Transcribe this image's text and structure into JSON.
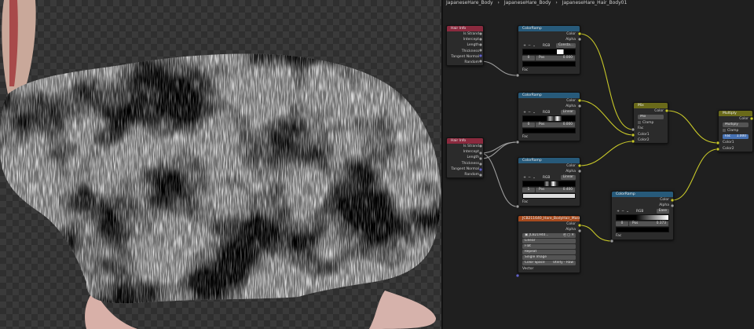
{
  "breadcrumb": [
    "JapaneseHare_Body",
    "JapaneseHare_Body",
    "JapaneseHare_Hair_Body01"
  ],
  "nodes": {
    "hair_info_1": {
      "title": "Hair Info",
      "outputs": [
        "Is Strand",
        "Intercept",
        "Length",
        "Thickness",
        "Tangent Normal",
        "Random"
      ]
    },
    "hair_info_2": {
      "title": "Hair Info",
      "outputs": [
        "Is Strand",
        "Intercept",
        "Length",
        "Thickness",
        "Tangent Normal",
        "Random"
      ]
    },
    "ramp_1": {
      "title": "ColorRamp",
      "outputs": [
        "Color",
        "Alpha"
      ],
      "color_mode": "RGB",
      "interpolation": "Consta...",
      "stop_index": "0",
      "pos_label": "Pos",
      "pos_value": "0.000",
      "input": "Fac"
    },
    "ramp_2": {
      "title": "ColorRamp",
      "outputs": [
        "Color",
        "Alpha"
      ],
      "color_mode": "RGB",
      "interpolation": "Linear",
      "stop_index": "0",
      "pos_label": "Pos",
      "pos_value": "0.000",
      "input": "Fac"
    },
    "ramp_3": {
      "title": "ColorRamp",
      "outputs": [
        "Color",
        "Alpha"
      ],
      "color_mode": "RGB",
      "interpolation": "Linear",
      "stop_index": "1",
      "pos_label": "Pos",
      "pos_value": "0.400",
      "input": "Fac"
    },
    "ramp_4": {
      "title": "ColorRamp",
      "outputs": [
        "Color",
        "Alpha"
      ],
      "color_mode": "RGB",
      "interpolation": "Ease",
      "stop_index": "0",
      "pos_label": "Pos",
      "pos_value": "0.373",
      "input": "Fac"
    },
    "mix": {
      "title": "Mix",
      "output": "Color",
      "mode": "Mix",
      "clamp": "Clamp",
      "inputs": [
        "Fac",
        "Color1",
        "Color2"
      ]
    },
    "multiply": {
      "title": "Multiply",
      "output": "Color",
      "mode": "Multiply",
      "clamp": "Clamp",
      "fac_label": "Fac",
      "fac_value": "1.000",
      "inputs": [
        "Color1",
        "Color2"
      ]
    },
    "image": {
      "title": "JCB211640_Hare_BodyHair_Mask.01...",
      "outputs": [
        "Color",
        "Alpha"
      ],
      "image_name": "JCB21940...",
      "options": [
        "Linear",
        "Flat",
        "Repeat",
        "Single Image"
      ],
      "color_space_label": "Color Space",
      "color_space_value": "Utility - Raw",
      "input": "Vector"
    }
  },
  "colors": {
    "socket_gray": "#9c9c9c",
    "socket_yellow": "#c7c729",
    "socket_purple": "#6363c7",
    "header_input": "#8a2a3e",
    "header_converter": "#275a7a",
    "header_mix": "#6a6a1a",
    "header_texture": "#a54a1e"
  }
}
